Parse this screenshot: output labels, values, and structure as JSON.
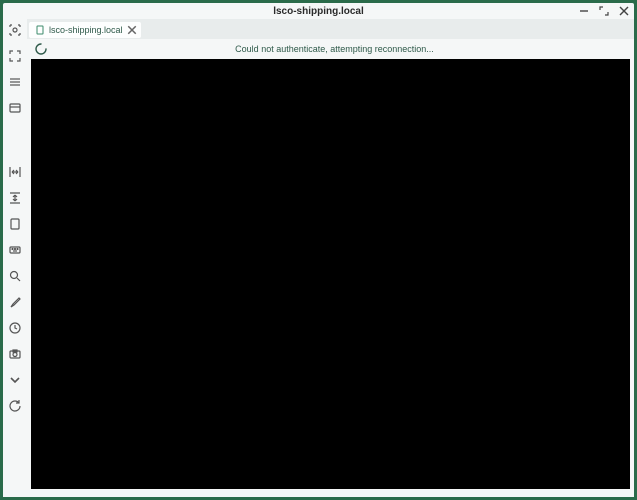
{
  "window": {
    "title": "lsco-shipping.local"
  },
  "tab": {
    "label": "lsco-shipping.local"
  },
  "status": {
    "message": "Could not authenticate, attempting reconnection..."
  },
  "sidebar": {
    "items": [
      {
        "name": "target-icon"
      },
      {
        "name": "fullscreen-icon"
      },
      {
        "name": "menu-icon"
      },
      {
        "name": "themes-icon"
      },
      {
        "name": "resize-horizontal-icon"
      },
      {
        "name": "resize-vertical-icon"
      },
      {
        "name": "page-icon"
      },
      {
        "name": "keyboard-icon"
      },
      {
        "name": "zoom-icon"
      },
      {
        "name": "tool-icon"
      },
      {
        "name": "clock-icon"
      },
      {
        "name": "camera-icon"
      },
      {
        "name": "chevron-down-icon"
      },
      {
        "name": "refresh-icon"
      }
    ]
  }
}
